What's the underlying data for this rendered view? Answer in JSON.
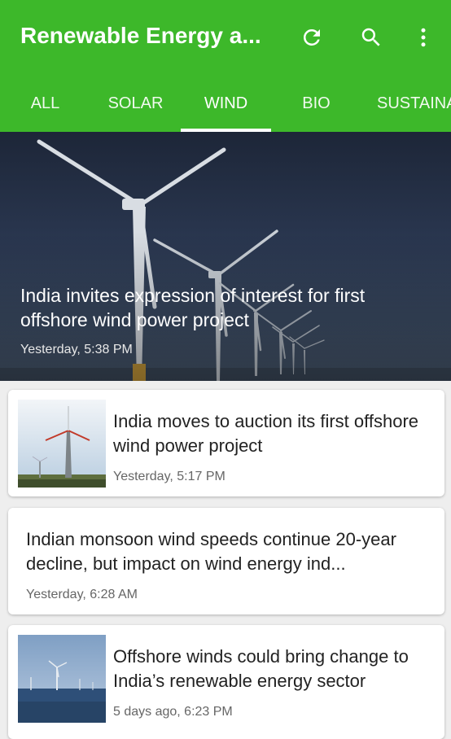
{
  "appbar": {
    "title": "Renewable Energy a...",
    "icons": [
      "refresh-icon",
      "search-icon",
      "more-vert-icon"
    ],
    "color": "#3db82a"
  },
  "tabs": [
    {
      "label": "ALL"
    },
    {
      "label": "SOLAR"
    },
    {
      "label": "WIND",
      "active": true
    },
    {
      "label": "BIO"
    },
    {
      "label": "SUSTAINA"
    }
  ],
  "hero": {
    "title": "India invites expression of interest for first offshore wind power project",
    "time": "Yesterday, 5:38 PM"
  },
  "articles": [
    {
      "title": "India moves to auction its first offshore wind power project",
      "time": "Yesterday, 5:17 PM",
      "has_image": true
    },
    {
      "title": "Indian monsoon wind speeds continue 20-year decline, but impact on wind energy ind...",
      "time": "Yesterday, 6:28 AM",
      "has_image": false
    },
    {
      "title": "Offshore winds could bring change to India’s renewable energy sector",
      "time": "5 days ago, 6:23 PM",
      "has_image": true
    }
  ]
}
